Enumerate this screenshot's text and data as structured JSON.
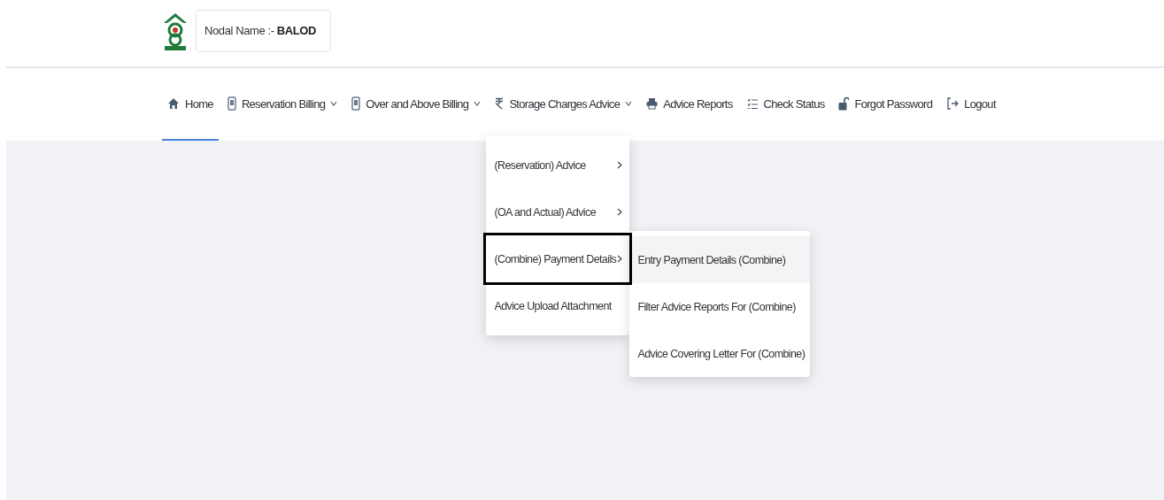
{
  "header": {
    "nodal_label": "Nodal Name :- ",
    "nodal_value": "BALOD"
  },
  "nav": [
    {
      "label": "Home",
      "kind": "home",
      "dropdown": false,
      "selected": true
    },
    {
      "label": "Reservation Billing",
      "kind": "document",
      "dropdown": true,
      "selected": false
    },
    {
      "label": "Over and Above Billing",
      "kind": "document",
      "dropdown": true,
      "selected": false
    },
    {
      "label": "Storage Charges Advice",
      "kind": "rupee",
      "dropdown": true,
      "selected": false,
      "expanded": true
    },
    {
      "label": "Advice Reports",
      "kind": "printer",
      "dropdown": false,
      "selected": false
    },
    {
      "label": "Check Status",
      "kind": "checklist",
      "dropdown": false,
      "selected": false
    },
    {
      "label": "Forgot Password",
      "kind": "lock",
      "dropdown": false,
      "selected": false
    },
    {
      "label": "Logout",
      "kind": "logout",
      "dropdown": false,
      "selected": false
    }
  ],
  "menu": [
    {
      "label": "(Reservation) Advice",
      "submenu": true,
      "highlighted": false
    },
    {
      "label": "(OA and Actual) Advice",
      "submenu": true,
      "highlighted": false
    },
    {
      "label": "(Combine) Payment Details",
      "submenu": true,
      "highlighted": true,
      "children": [
        {
          "label": "Entry Payment Details (Combine)",
          "hovered": true
        },
        {
          "label": "Filter Advice Reports For (Combine)",
          "hovered": false
        },
        {
          "label": "Advice Covering Letter For (Combine)",
          "hovered": false
        }
      ]
    },
    {
      "label": "Advice Upload Attachment",
      "submenu": false,
      "highlighted": false
    }
  ]
}
